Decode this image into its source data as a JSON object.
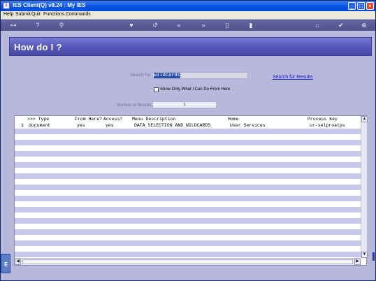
{
  "window": {
    "title": "IES Client(Q) v8.24 : My IES",
    "icon_label": "i",
    "controls": {
      "minimize": "_",
      "maximize": "□",
      "close": "×"
    }
  },
  "menu": [
    "Help",
    "Submit",
    "Quit",
    "Functions",
    "Commands"
  ],
  "toolbar": {
    "icons": [
      "key-icon",
      "help-icon",
      "search-icon",
      "heart-icon",
      "refresh-icon",
      "back-icon",
      "forward-icon",
      "document-icon",
      "page-icon",
      "home-icon",
      "ok-icon",
      "close-icon"
    ],
    "glyphs": [
      "⊶",
      "?",
      "⚲",
      "♥",
      "↺",
      "«",
      "»",
      "▯",
      "▮",
      "⌂",
      "✔",
      "⊗"
    ]
  },
  "banner": {
    "title": "How do I ?"
  },
  "search": {
    "label": "Search For",
    "value": "wildcards",
    "link": "Search for Results"
  },
  "filter": {
    "checkbox_label": "Show Only What I Can Do From Here",
    "checked": false
  },
  "results_count": {
    "label": "Number of Results",
    "value": "1"
  },
  "grid": {
    "columns": [
      ">>> Type",
      "From Here?",
      "Access?",
      "Menu Description",
      "Home",
      "Process Key"
    ],
    "rows": [
      {
        "num": "1",
        "type": "document",
        "from_here": "yes",
        "access": "yes",
        "description": "DATA SELECTION AND WILDCARDS",
        "home": "User Services",
        "process_key": "ur-selproatps"
      }
    ]
  },
  "edge": {
    "tab_label": "E"
  },
  "colors": {
    "titlebar": "#0a58e8",
    "banner": "#5454b8",
    "background": "#b8b8dc",
    "alt_row": "#c8c8ec",
    "link": "#1a1ad2"
  }
}
